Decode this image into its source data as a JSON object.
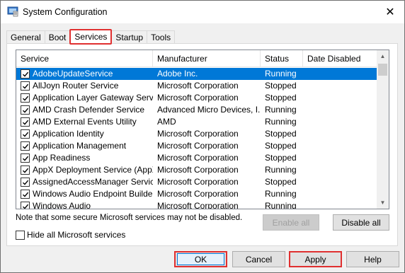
{
  "window": {
    "title": "System Configuration",
    "close_glyph": "✕"
  },
  "tabs": [
    {
      "label": "General",
      "active": false
    },
    {
      "label": "Boot",
      "active": false
    },
    {
      "label": "Services",
      "active": true
    },
    {
      "label": "Startup",
      "active": false
    },
    {
      "label": "Tools",
      "active": false
    }
  ],
  "services_table": {
    "columns": [
      "Service",
      "Manufacturer",
      "Status",
      "Date Disabled"
    ],
    "rows": [
      {
        "service": "AdobeUpdateService",
        "manufacturer": "Adobe Inc.",
        "status": "Running",
        "date_disabled": "",
        "checked": true,
        "selected": true
      },
      {
        "service": "AllJoyn Router Service",
        "manufacturer": "Microsoft Corporation",
        "status": "Stopped",
        "date_disabled": "",
        "checked": true,
        "selected": false
      },
      {
        "service": "Application Layer Gateway Service",
        "manufacturer": "Microsoft Corporation",
        "status": "Stopped",
        "date_disabled": "",
        "checked": true,
        "selected": false
      },
      {
        "service": "AMD Crash Defender Service",
        "manufacturer": "Advanced Micro Devices, I...",
        "status": "Running",
        "date_disabled": "",
        "checked": true,
        "selected": false
      },
      {
        "service": "AMD External Events Utility",
        "manufacturer": "AMD",
        "status": "Running",
        "date_disabled": "",
        "checked": true,
        "selected": false
      },
      {
        "service": "Application Identity",
        "manufacturer": "Microsoft Corporation",
        "status": "Stopped",
        "date_disabled": "",
        "checked": true,
        "selected": false
      },
      {
        "service": "Application Management",
        "manufacturer": "Microsoft Corporation",
        "status": "Stopped",
        "date_disabled": "",
        "checked": true,
        "selected": false
      },
      {
        "service": "App Readiness",
        "manufacturer": "Microsoft Corporation",
        "status": "Stopped",
        "date_disabled": "",
        "checked": true,
        "selected": false
      },
      {
        "service": "AppX Deployment Service (AppX...",
        "manufacturer": "Microsoft Corporation",
        "status": "Running",
        "date_disabled": "",
        "checked": true,
        "selected": false
      },
      {
        "service": "AssignedAccessManager Service",
        "manufacturer": "Microsoft Corporation",
        "status": "Stopped",
        "date_disabled": "",
        "checked": true,
        "selected": false
      },
      {
        "service": "Windows Audio Endpoint Builder",
        "manufacturer": "Microsoft Corporation",
        "status": "Running",
        "date_disabled": "",
        "checked": true,
        "selected": false
      },
      {
        "service": "Windows Audio",
        "manufacturer": "Microsoft Corporation",
        "status": "Running",
        "date_disabled": "",
        "checked": true,
        "selected": false
      }
    ]
  },
  "note": "Note that some secure Microsoft services may not be disabled.",
  "buttons": {
    "enable_all": "Enable all",
    "disable_all": "Disable all",
    "ok": "OK",
    "cancel": "Cancel",
    "apply": "Apply",
    "help": "Help"
  },
  "hide_ms": {
    "label": "Hide all Microsoft services",
    "checked": false
  },
  "colors": {
    "selection": "#0078d7",
    "highlight_outline": "#e03030"
  }
}
